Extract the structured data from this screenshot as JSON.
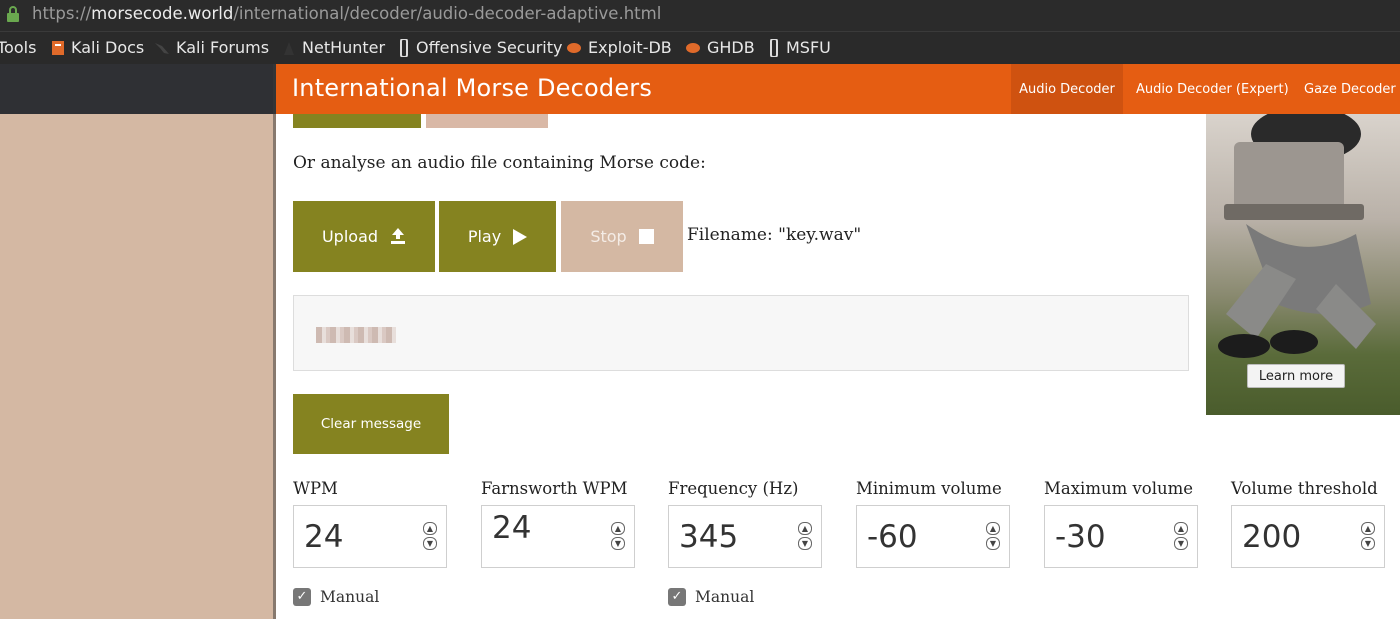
{
  "browser": {
    "url_prefix": "https://",
    "url_domain": "morsecode.world",
    "url_path": "/international/decoder/audio-decoder-adaptive.html",
    "bookmarks": [
      "Tools",
      "Kali Docs",
      "Kali Forums",
      "NetHunter",
      "Offensive Security",
      "Exploit-DB",
      "GHDB",
      "MSFU"
    ]
  },
  "header": {
    "title": "International Morse Decoders",
    "nav": [
      "Audio Decoder",
      "Audio Decoder (Expert)",
      "Gaze Decoder"
    ]
  },
  "main": {
    "intro": "Or analyse an audio file containing Morse code:",
    "upload_label": "Upload",
    "play_label": "Play",
    "stop_label": "Stop",
    "filename": "Filename: \"key.wav\"",
    "clear_label": "Clear message"
  },
  "settings": {
    "wpm": {
      "label": "WPM",
      "value": "24"
    },
    "farnsworth": {
      "label": "Farnsworth WPM",
      "value": "24"
    },
    "frequency": {
      "label": "Frequency (Hz)",
      "value": "345"
    },
    "min_volume": {
      "label": "Minimum volume",
      "value": "-60"
    },
    "max_volume": {
      "label": "Maximum volume",
      "value": "-30"
    },
    "threshold": {
      "label": "Volume threshold",
      "value": "200"
    },
    "manual_label": "Manual"
  },
  "ad": {
    "button": "Learn more"
  },
  "colors": {
    "header": "#e55d12",
    "button": "#858320",
    "disabled_button": "#d4b8a3"
  }
}
